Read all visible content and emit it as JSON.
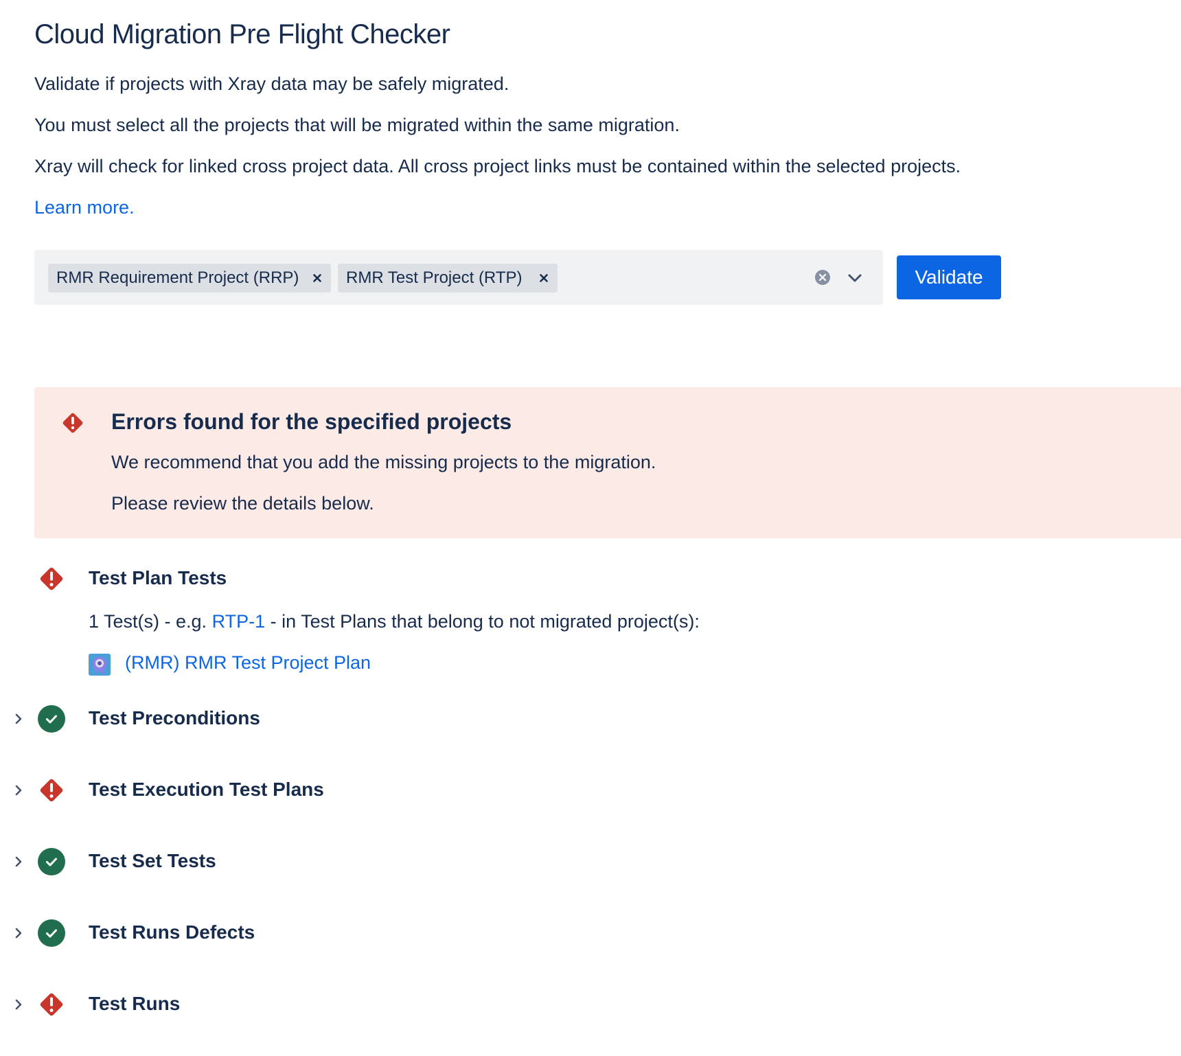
{
  "header": {
    "title": "Cloud Migration Pre Flight Checker",
    "description_1": "Validate if projects with Xray data may be safely migrated.",
    "description_2": "You must select all the projects that will be migrated within the same migration.",
    "description_3": "Xray will check for linked cross project data. All cross project links must be contained within the selected projects.",
    "learn_more": "Learn more."
  },
  "project_select": {
    "selected": [
      {
        "label": "RMR Requirement Project (RRP)"
      },
      {
        "label": "RMR Test Project (RTP)"
      }
    ],
    "clear_icon": "clear-circle-icon",
    "dropdown_icon": "chevron-down-icon"
  },
  "validate_button": {
    "label": "Validate",
    "color": "#0c66e4"
  },
  "error_banner": {
    "title": "Errors found for the specified projects",
    "line_1": "We recommend that you add the missing projects to the migration.",
    "line_2": "Please review the details below.",
    "background": "#fbeae6",
    "icon": "error-diamond-icon"
  },
  "colors": {
    "error": "#c9372c",
    "success": "#216e4e",
    "text": "#172b4d",
    "link": "#0c66e4"
  },
  "sections": [
    {
      "title": "Test Plan Tests",
      "status": "error",
      "expanded": true,
      "detail_prefix": "1 Test(s) - e.g. ",
      "detail_link": "RTP-1",
      "detail_suffix": " - in Test Plans that belong to not migrated project(s):",
      "plan_link": "(RMR) RMR Test Project Plan",
      "plan_icon": "project-avatar-icon"
    },
    {
      "title": "Test Preconditions",
      "status": "success",
      "expanded": false
    },
    {
      "title": "Test Execution Test Plans",
      "status": "error",
      "expanded": false
    },
    {
      "title": "Test Set Tests",
      "status": "success",
      "expanded": false
    },
    {
      "title": "Test Runs Defects",
      "status": "success",
      "expanded": false
    },
    {
      "title": "Test Runs",
      "status": "error",
      "expanded": false
    }
  ]
}
